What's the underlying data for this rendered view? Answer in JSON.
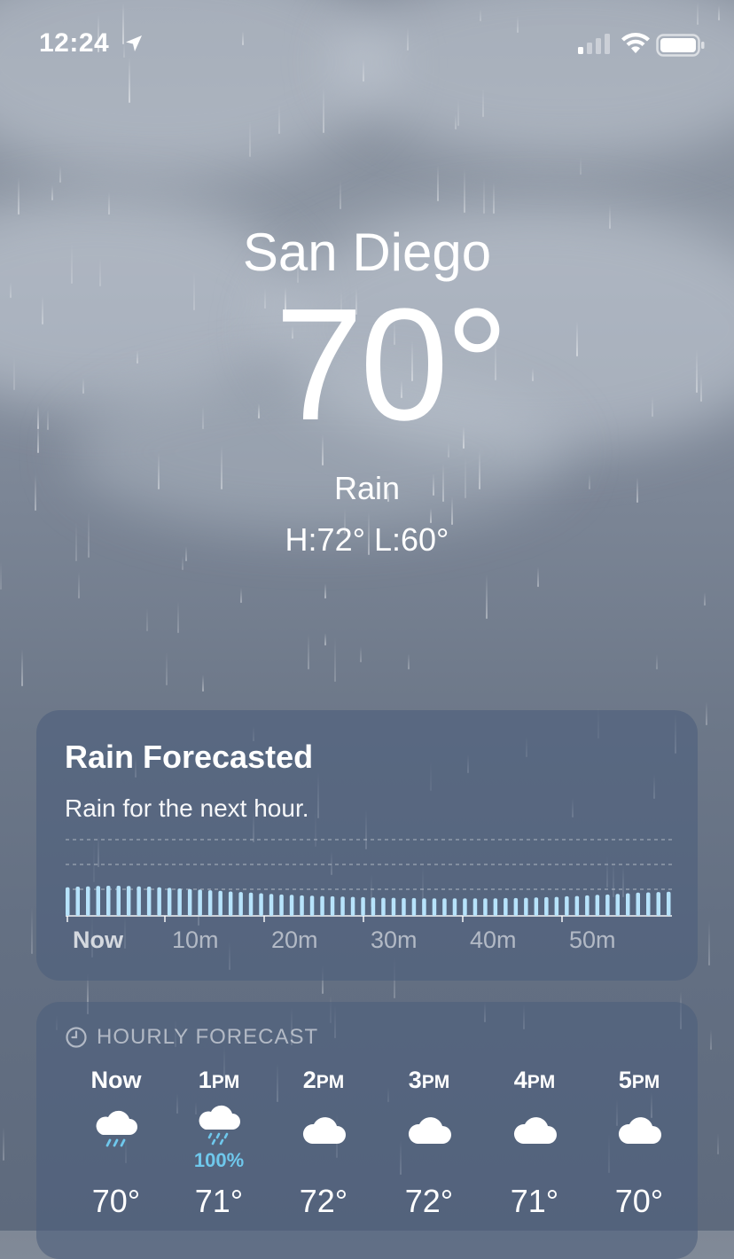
{
  "status_bar": {
    "time": "12:24",
    "location_icon": "location-arrow-icon",
    "signal_icon": "cellular-signal-icon",
    "wifi_icon": "wifi-icon",
    "battery_icon": "battery-icon"
  },
  "location": {
    "city": "San Diego",
    "temperature": "70°",
    "condition": "Rain",
    "high_low": "H:72°  L:60°"
  },
  "rain_card": {
    "title": "Rain Forecasted",
    "subtitle": "Rain for the next hour.",
    "accent_color": "#b7e3fb",
    "chart_data": {
      "type": "bar",
      "x_tick_labels": [
        "Now",
        "10m",
        "20m",
        "30m",
        "40m",
        "50m"
      ],
      "intensity_note_levels": 3,
      "values": [
        0.95,
        0.97,
        0.98,
        0.99,
        1.0,
        1.0,
        0.99,
        0.98,
        0.97,
        0.95,
        0.93,
        0.91,
        0.89,
        0.87,
        0.85,
        0.83,
        0.81,
        0.79,
        0.77,
        0.75,
        0.73,
        0.71,
        0.7,
        0.68,
        0.67,
        0.66,
        0.65,
        0.64,
        0.63,
        0.62,
        0.61,
        0.6,
        0.6,
        0.59,
        0.59,
        0.58,
        0.58,
        0.58,
        0.58,
        0.58,
        0.58,
        0.58,
        0.58,
        0.59,
        0.59,
        0.6,
        0.61,
        0.62,
        0.63,
        0.65,
        0.66,
        0.68,
        0.7,
        0.71,
        0.73,
        0.75,
        0.77,
        0.78,
        0.79,
        0.8
      ],
      "grid": true
    }
  },
  "hourly": {
    "header": "HOURLY FORECAST",
    "header_icon": "clock-icon",
    "precip_color": "#6fc8ec",
    "items": [
      {
        "time": "Now",
        "ampm": "",
        "icon": "rain-icon",
        "precip": "",
        "temp": "70°"
      },
      {
        "time": "1",
        "ampm": "PM",
        "icon": "heavy-rain-icon",
        "precip": "100%",
        "temp": "71°"
      },
      {
        "time": "2",
        "ampm": "PM",
        "icon": "cloud-icon",
        "precip": "",
        "temp": "72°"
      },
      {
        "time": "3",
        "ampm": "PM",
        "icon": "cloud-icon",
        "precip": "",
        "temp": "72°"
      },
      {
        "time": "4",
        "ampm": "PM",
        "icon": "cloud-icon",
        "precip": "",
        "temp": "71°"
      },
      {
        "time": "5",
        "ampm": "PM",
        "icon": "cloud-icon",
        "precip": "",
        "temp": "70°"
      }
    ]
  }
}
